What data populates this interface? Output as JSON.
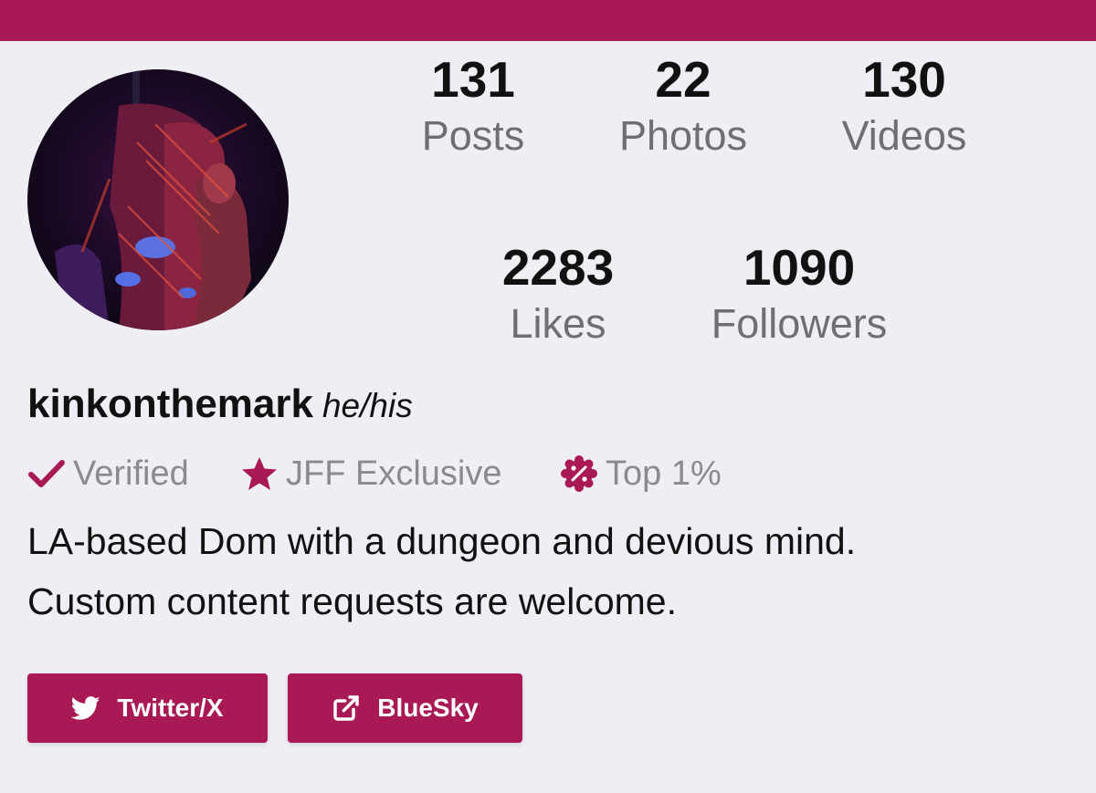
{
  "colors": {
    "accent": "#a91955",
    "background": "#efeef5",
    "muted_text": "#6e6e73",
    "text": "#111111"
  },
  "profile": {
    "username": "kinkonthemark",
    "pronouns": "he/his",
    "avatar_icon": "profile-photo"
  },
  "stats": {
    "posts": {
      "value": "131",
      "label": "Posts"
    },
    "photos": {
      "value": "22",
      "label": "Photos"
    },
    "videos": {
      "value": "130",
      "label": "Videos"
    },
    "likes": {
      "value": "2283",
      "label": "Likes"
    },
    "followers": {
      "value": "1090",
      "label": "Followers"
    }
  },
  "badges": [
    {
      "icon": "check-icon",
      "label": "Verified"
    },
    {
      "icon": "star-icon",
      "label": "JFF Exclusive"
    },
    {
      "icon": "percent-badge-icon",
      "label": "Top 1%"
    }
  ],
  "bio": {
    "line1": "LA-based Dom with a dungeon and devious mind.",
    "line2": "Custom content requests are welcome."
  },
  "links": [
    {
      "icon": "twitter-icon",
      "label": "Twitter/X"
    },
    {
      "icon": "external-link-icon",
      "label": "BlueSky"
    }
  ]
}
